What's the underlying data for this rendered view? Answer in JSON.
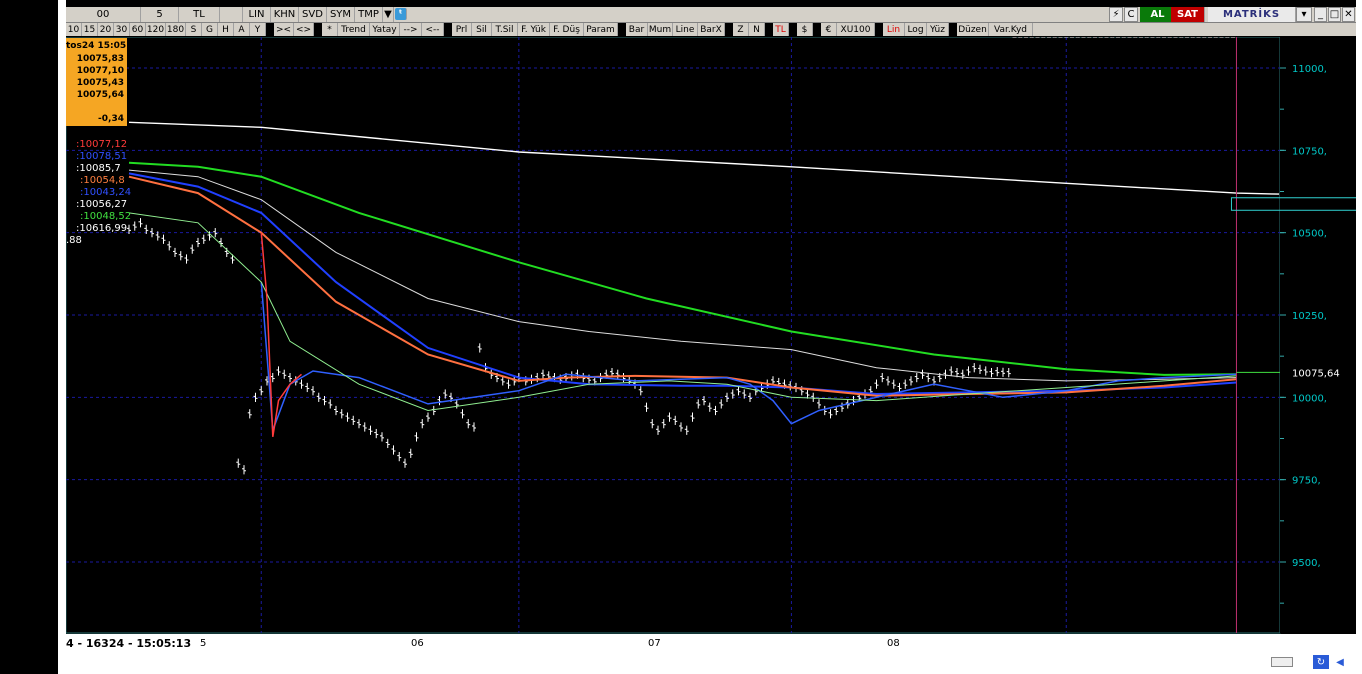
{
  "toolbar": {
    "row1": [
      {
        "label": "00",
        "w": 75
      },
      {
        "label": "5",
        "w": 38
      },
      {
        "label": "TL",
        "w": 41
      },
      {
        "label": "",
        "w": 23
      },
      {
        "label": "LIN",
        "w": 28
      },
      {
        "label": "KHN",
        "w": 28
      },
      {
        "label": "SVD",
        "w": 28
      },
      {
        "label": "SYM",
        "w": 28
      },
      {
        "label": "TMP",
        "w": 28
      },
      {
        "label": "▼",
        "w": 11
      }
    ],
    "row2": [
      "10",
      "15",
      "20",
      "30",
      "60",
      "120",
      "180",
      "S",
      "G",
      "H",
      "A",
      "Y",
      "",
      "><",
      "<>",
      "",
      "*",
      "Trend",
      "Yatay",
      "-->",
      "<--",
      "",
      "Prl",
      "Sil",
      "T.Sil",
      "F. Yük",
      "F. Düş",
      "Param",
      "",
      "Bar",
      "Mum",
      "Line",
      "BarX",
      "",
      "Z",
      "N",
      "",
      "TL",
      "",
      "$",
      "",
      "€",
      "XU100",
      "",
      "Lin",
      "Log",
      "Yüz",
      "",
      "Düzen",
      "Var.Kyd"
    ],
    "right": {
      "al": "AL",
      "sat": "SAT",
      "logo": "MATRİKS"
    }
  },
  "info_box": {
    "date": "tos24 15:05",
    "lines": [
      "10075,83",
      "10077,10",
      "10075,43",
      "10075,64"
    ],
    "change": "-0,34"
  },
  "legend": [
    {
      "text": ":10077,12",
      "color": "#ff3b3b"
    },
    {
      "text": ":10078,51",
      "color": "#3050ff"
    },
    {
      "text": ":10085,7",
      "color": "#ffffff"
    },
    {
      "text": ":10054,8",
      "color": "#ff7f40"
    },
    {
      "text": ":10043,24",
      "color": "#3050ff"
    },
    {
      "text": ":10056,27",
      "color": "#ffffff"
    },
    {
      "text": ":10048,52",
      "color": "#40e040"
    },
    {
      "text": ":10616,99",
      "color": "#ffffff"
    },
    {
      "text": ".88",
      "color": "#ffffff"
    }
  ],
  "bottom": {
    "status": "4 - 16324 - 15:05:13",
    "x_labels": [
      "5",
      "06",
      "07",
      "08"
    ]
  },
  "chart_data": {
    "type": "line",
    "ylim": [
      9350,
      11100
    ],
    "yticks": [
      "11000,",
      "10750,",
      "10500,",
      "10250,",
      "10000,",
      "9750,",
      "9500,"
    ],
    "ytick_values": [
      11000,
      10750,
      10500,
      10250,
      10000,
      9750,
      9500
    ],
    "last_price_label": "10075,64",
    "last_price": 10075.64,
    "x_range": [
      0,
      1000
    ],
    "x_day_marks": [
      115,
      339,
      576,
      815
    ],
    "cursor_x": 963,
    "series": [
      {
        "color": "#ffffff",
        "width": 1.4,
        "x": [
          0,
          115,
          339,
          576,
          815,
          963,
          1000
        ],
        "y": [
          10835,
          10820,
          10745,
          10700,
          10650,
          10620,
          10617
        ]
      },
      {
        "color": "#22dd22",
        "width": 2,
        "x": [
          0,
          60,
          115,
          200,
          339,
          450,
          576,
          700,
          815,
          900,
          963
        ],
        "y": [
          10712,
          10700,
          10670,
          10560,
          10410,
          10300,
          10200,
          10130,
          10085,
          10068,
          10070
        ]
      },
      {
        "color": "#dddddd",
        "width": 1,
        "x": [
          0,
          60,
          115,
          180,
          260,
          339,
          400,
          480,
          576,
          650,
          730,
          815,
          900,
          963
        ],
        "y": [
          10690,
          10670,
          10600,
          10440,
          10300,
          10230,
          10200,
          10170,
          10145,
          10090,
          10060,
          10050,
          10055,
          10060
        ]
      },
      {
        "color": "#2040ff",
        "width": 2,
        "x": [
          0,
          60,
          115,
          180,
          260,
          339,
          400,
          480,
          520,
          576,
          650,
          730,
          815,
          900,
          963
        ],
        "y": [
          10680,
          10640,
          10560,
          10350,
          10150,
          10060,
          10040,
          10035,
          10035,
          10030,
          10010,
          10015,
          10020,
          10030,
          10045
        ]
      },
      {
        "color": "#ff7040",
        "width": 2,
        "x": [
          0,
          60,
          115,
          180,
          260,
          339,
          380,
          440,
          520,
          576,
          650,
          730,
          815,
          900,
          963
        ],
        "y": [
          10670,
          10620,
          10500,
          10290,
          10130,
          10050,
          10060,
          10065,
          10060,
          10030,
          10005,
          10010,
          10015,
          10035,
          10055
        ]
      },
      {
        "color": "#3060ff",
        "width": 1.5,
        "x": [
          115,
          125,
          140,
          160,
          200,
          260,
          339,
          380,
          440,
          520,
          540,
          560,
          576,
          600,
          650,
          700,
          760,
          815,
          860,
          900,
          963
        ],
        "y": [
          10350,
          9900,
          10040,
          10080,
          10060,
          9980,
          10020,
          10070,
          10050,
          10060,
          10040,
          9990,
          9920,
          9960,
          10000,
          10040,
          10000,
          10020,
          10050,
          10060,
          10070
        ]
      },
      {
        "color": "#90ee90",
        "width": 1,
        "x": [
          0,
          60,
          115,
          140,
          200,
          260,
          339,
          400,
          470,
          520,
          576,
          650,
          730,
          815,
          900,
          963
        ],
        "y": [
          10560,
          10530,
          10350,
          10170,
          10040,
          9960,
          10000,
          10040,
          10050,
          10040,
          10000,
          9990,
          10010,
          10030,
          10050,
          10065
        ]
      },
      {
        "color": "#ff3b3b",
        "width": 1.5,
        "x": [
          115,
          120,
          125,
          130,
          140,
          150
        ],
        "y": [
          10500,
          10300,
          9880,
          9990,
          10040,
          10070
        ]
      }
    ],
    "price_bars": {
      "x": [
        0,
        5,
        10,
        15,
        20,
        25,
        30,
        35,
        40,
        45,
        50,
        55,
        60,
        65,
        70,
        75,
        80,
        85,
        90,
        95,
        100,
        105,
        110,
        115,
        120,
        125,
        130,
        135,
        140,
        145,
        150,
        155,
        160,
        165,
        170,
        175,
        180,
        185,
        190,
        195,
        200,
        205,
        210,
        215,
        220,
        225,
        230,
        235,
        240,
        245,
        250,
        255,
        260,
        265,
        270,
        275,
        280,
        285,
        290,
        295,
        300,
        305,
        310,
        315,
        320,
        325,
        330,
        335,
        339,
        345,
        350,
        355,
        360,
        365,
        370,
        375,
        380,
        385,
        390,
        395,
        400,
        405,
        410,
        415,
        420,
        425,
        430,
        435,
        440,
        445,
        450,
        455,
        460,
        465,
        470,
        475,
        480,
        485,
        490,
        495,
        500,
        505,
        510,
        515,
        520,
        525,
        530,
        535,
        540,
        545,
        550,
        555,
        560,
        565,
        570,
        575,
        580,
        585,
        590,
        595,
        600,
        605,
        610,
        615,
        620,
        625,
        630,
        635,
        640,
        645,
        650,
        655,
        660,
        665,
        670,
        675,
        680,
        685,
        690,
        695,
        700,
        705,
        710,
        715,
        720,
        725,
        730,
        735,
        740,
        745,
        750,
        755,
        760,
        765,
        770,
        775,
        780,
        785,
        790,
        795,
        800,
        805,
        810,
        815,
        820,
        825,
        830,
        835,
        840,
        845,
        850,
        855,
        860,
        865,
        870,
        875,
        880,
        885,
        890,
        895,
        900,
        905,
        910,
        915,
        920,
        925,
        930,
        935,
        940,
        945,
        950,
        955,
        960
      ],
      "y": [
        10510,
        10520,
        10530,
        10510,
        10500,
        10490,
        10480,
        10460,
        10440,
        10430,
        10420,
        10450,
        10470,
        10480,
        10490,
        10500,
        10470,
        10440,
        10420,
        9800,
        9780,
        9950,
        10000,
        10020,
        10050,
        10060,
        10080,
        10070,
        10060,
        10050,
        10040,
        10030,
        10020,
        10000,
        9990,
        9980,
        9960,
        9950,
        9940,
        9930,
        9920,
        9910,
        9900,
        9890,
        9880,
        9860,
        9840,
        9820,
        9800,
        9830,
        9880,
        9920,
        9940,
        9960,
        9990,
        10010,
        10000,
        9980,
        9950,
        9920,
        9910,
        10150,
        10090,
        10070,
        10060,
        10050,
        10040,
        10050,
        10060,
        10050,
        10055,
        10060,
        10070,
        10065,
        10060,
        10055,
        10060,
        10065,
        10070,
        10060,
        10055,
        10050,
        10060,
        10070,
        10075,
        10070,
        10060,
        10050,
        10040,
        10020,
        9970,
        9920,
        9900,
        9920,
        9940,
        9930,
        9910,
        9900,
        9940,
        9980,
        9990,
        9970,
        9960,
        9980,
        10000,
        10010,
        10020,
        10010,
        10000,
        10020,
        10030,
        10040,
        10050,
        10045,
        10040,
        10035,
        10030,
        10020,
        10010,
        10000,
        9980,
        9960,
        9950,
        9960,
        9970,
        9980,
        9990,
        10000,
        10010,
        10020,
        10040,
        10060,
        10050,
        10040,
        10030,
        10040,
        10050,
        10060,
        10070,
        10060,
        10050,
        10060,
        10070,
        10080,
        10075,
        10070,
        10080,
        10090,
        10085,
        10080,
        10075,
        10078,
        10076,
        10075
      ],
      "halfrange": 14
    }
  }
}
